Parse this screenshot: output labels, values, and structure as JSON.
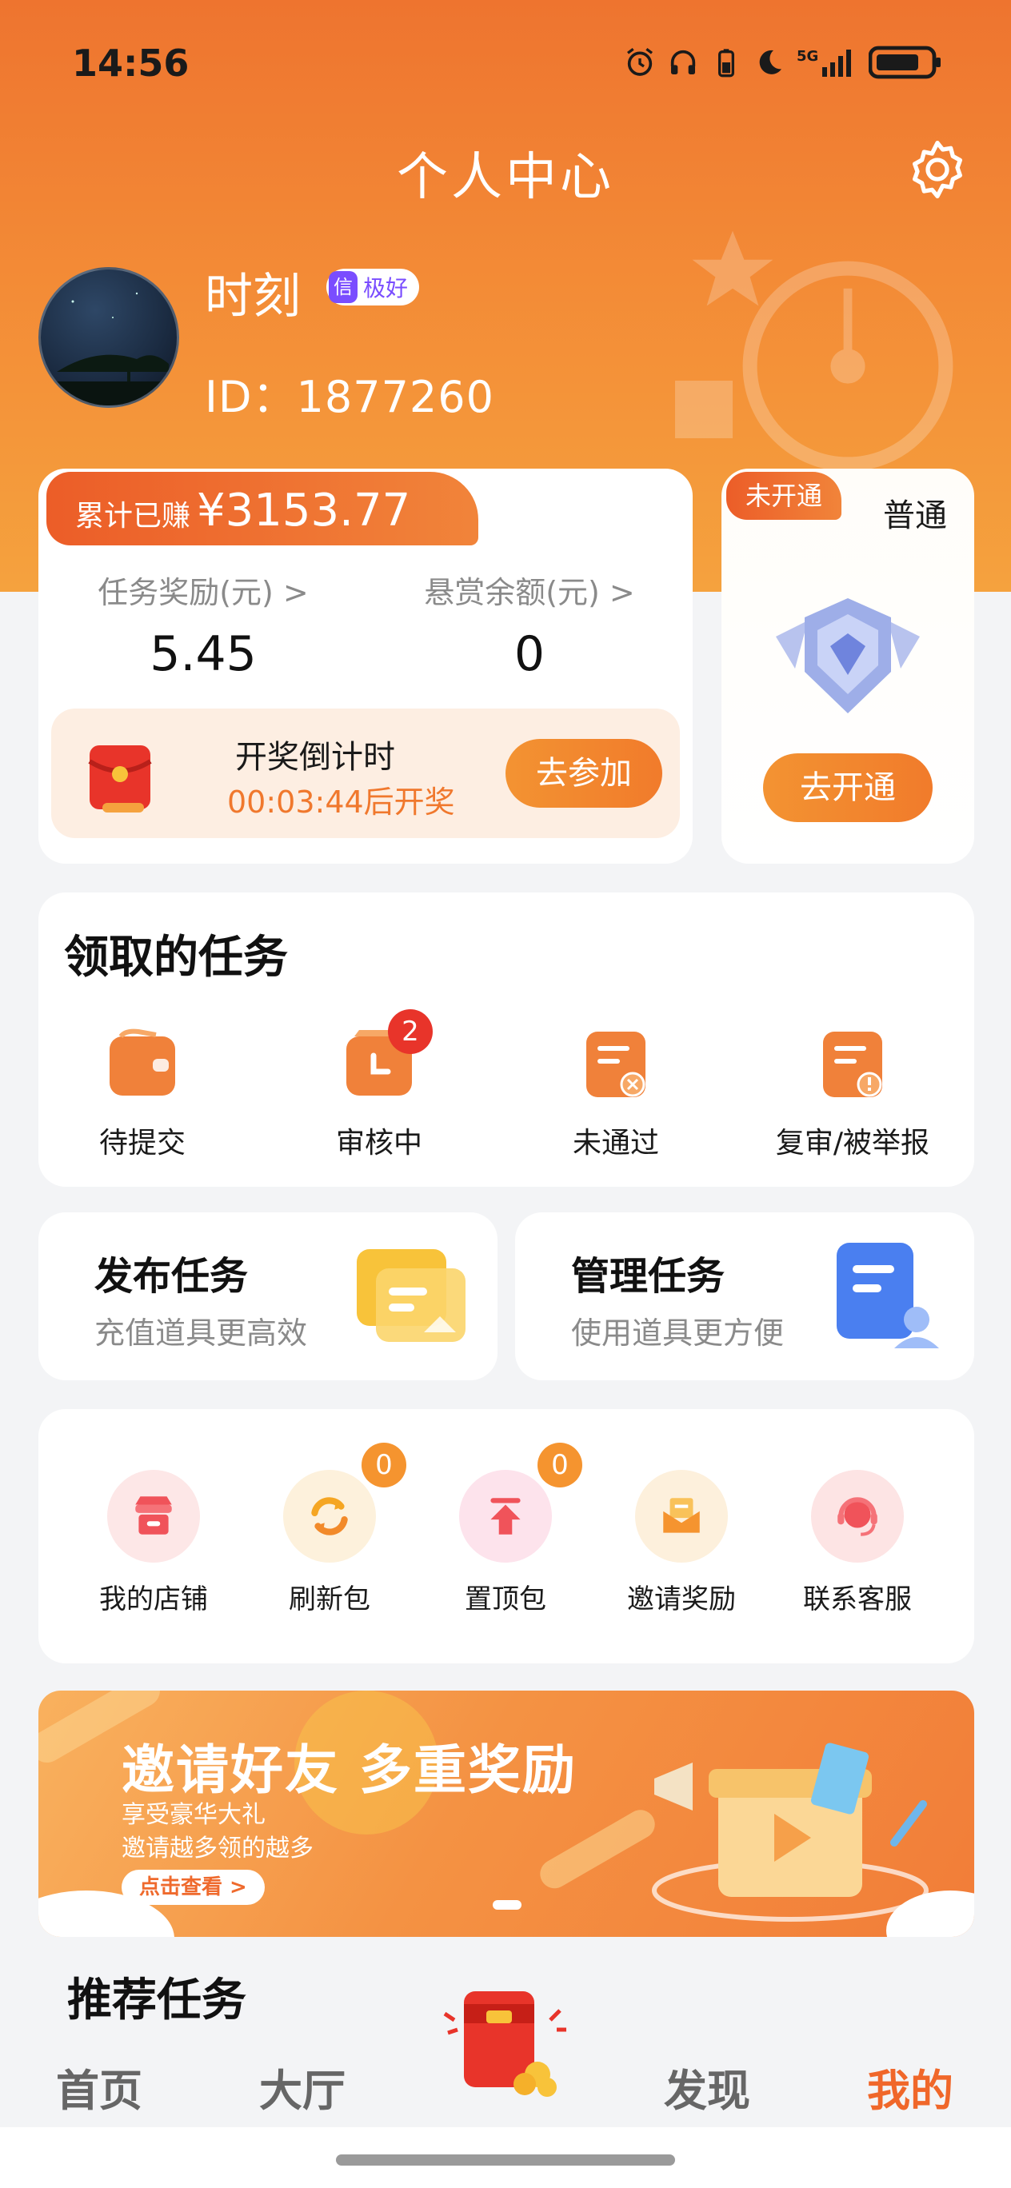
{
  "status": {
    "time": "14:56",
    "network": "5G"
  },
  "header": {
    "title": "个人中心"
  },
  "user": {
    "name": "时刻",
    "credit_mark": "信",
    "credit_level": "极好",
    "id_text": "ID：1877260"
  },
  "earnings": {
    "total_label": "累计已赚",
    "total_amount": "¥3153.77",
    "task_reward_label": "任务奖励(元) >",
    "task_reward_value": "5.45",
    "bounty_label": "悬赏余额(元) >",
    "bounty_value": "0",
    "lottery_title": "开奖倒计时",
    "lottery_countdown": "00:03:44后开奖",
    "lottery_button": "去参加"
  },
  "membership": {
    "status_tag": "未开通",
    "level": "普通",
    "button": "去开通"
  },
  "received_tasks": {
    "title": "领取的任务",
    "items": [
      {
        "label": "待提交",
        "badge": ""
      },
      {
        "label": "审核中",
        "badge": "2"
      },
      {
        "label": "未通过",
        "badge": ""
      },
      {
        "label": "复审/被举报",
        "badge": ""
      }
    ]
  },
  "publish": {
    "title": "发布任务",
    "subtitle": "充值道具更高效"
  },
  "manage": {
    "title": "管理任务",
    "subtitle": "使用道具更方便"
  },
  "tools": [
    {
      "label": "我的店铺",
      "badge": ""
    },
    {
      "label": "刷新包",
      "badge": "0"
    },
    {
      "label": "置顶包",
      "badge": "0"
    },
    {
      "label": "邀请奖励",
      "badge": ""
    },
    {
      "label": "联系客服",
      "badge": ""
    }
  ],
  "banner": {
    "title": "邀请好友 多重奖励",
    "line1": "享受豪华大礼",
    "line2": "邀请越多领的越多",
    "button": "点击查看 >"
  },
  "recommend": {
    "title": "推荐任务"
  },
  "tabbar": {
    "home": "首页",
    "hall": "大厅",
    "discover": "发现",
    "mine": "我的"
  },
  "colors": {
    "accent": "#f0672a",
    "header_top": "#ee742f",
    "badge_red": "#e8342a",
    "badge_orange": "#f5942f",
    "credit_purple": "#7a4dff"
  }
}
